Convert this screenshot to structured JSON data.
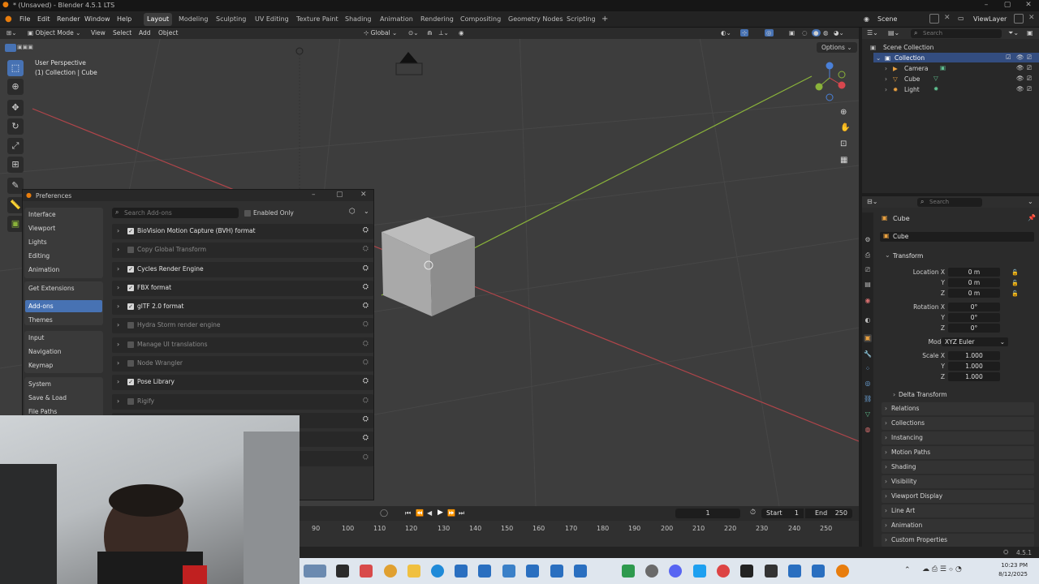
{
  "window": {
    "title": "* (Unsaved) - Blender 4.5.1 LTS"
  },
  "menu": {
    "items": [
      "File",
      "Edit",
      "Render",
      "Window",
      "Help"
    ],
    "workspaces": [
      "Layout",
      "Modeling",
      "Sculpting",
      "UV Editing",
      "Texture Paint",
      "Shading",
      "Animation",
      "Rendering",
      "Compositing",
      "Geometry Nodes",
      "Scripting"
    ],
    "active_workspace": "Layout",
    "add_workspace": "+",
    "scene": "Scene",
    "view_layer": "ViewLayer"
  },
  "viewport": {
    "mode": "Object Mode",
    "menus": [
      "View",
      "Select",
      "Add",
      "Object"
    ],
    "orientation": "Global",
    "options": "Options",
    "overlay_line1": "User Perspective",
    "overlay_line2": "(1) Collection | Cube"
  },
  "preferences": {
    "title": "Preferences",
    "search_placeholder": "Search Add-ons",
    "enabled_only": "Enabled Only",
    "categories_group1": [
      "Interface",
      "Viewport",
      "Lights",
      "Editing",
      "Animation"
    ],
    "categories_group2": [
      "Get Extensions",
      "Add-ons",
      "Themes"
    ],
    "categories_group3": [
      "Input",
      "Navigation",
      "Keymap"
    ],
    "categories_group4": [
      "System",
      "Save & Load",
      "File Paths"
    ],
    "active_category": "Add-ons",
    "addons": [
      {
        "name": "BioVision Motion Capture (BVH) format",
        "enabled": true
      },
      {
        "name": "Copy Global Transform",
        "enabled": false
      },
      {
        "name": "Cycles Render Engine",
        "enabled": true
      },
      {
        "name": "FBX format",
        "enabled": true
      },
      {
        "name": "glTF 2.0 format",
        "enabled": true
      },
      {
        "name": "Hydra Storm render engine",
        "enabled": false
      },
      {
        "name": "Manage UI translations",
        "enabled": false
      },
      {
        "name": "Node Wrangler",
        "enabled": false
      },
      {
        "name": "Pose Library",
        "enabled": true
      },
      {
        "name": "Rigify",
        "enabled": false
      }
    ]
  },
  "outliner": {
    "search_placeholder": "Search",
    "root": "Scene Collection",
    "collection": "Collection",
    "objects": [
      "Camera",
      "Cube",
      "Light"
    ]
  },
  "properties": {
    "search_placeholder": "Search",
    "object_name": "Cube",
    "data_name": "Cube",
    "panel_transform": "Transform",
    "location_label": "Location X",
    "location": [
      "0 m",
      "0 m",
      "0 m"
    ],
    "rotation_label": "Rotation X",
    "rotation": [
      "0°",
      "0°",
      "0°"
    ],
    "mode_label": "Mode",
    "mode_value": "XYZ Euler",
    "scale_label": "Scale X",
    "scale": [
      "1.000",
      "1.000",
      "1.000"
    ],
    "axis_y": "Y",
    "axis_z": "Z",
    "delta_transform": "Delta Transform",
    "panels": [
      "Relations",
      "Collections",
      "Instancing",
      "Motion Paths",
      "Shading",
      "Visibility",
      "Viewport Display",
      "Line Art",
      "Animation",
      "Custom Properties"
    ]
  },
  "timeline": {
    "current_frame": "1",
    "start_label": "Start",
    "start": "1",
    "end_label": "End",
    "end": "250",
    "ticks": [
      "90",
      "100",
      "110",
      "120",
      "130",
      "140",
      "150",
      "160",
      "170",
      "180",
      "190",
      "200",
      "210",
      "220",
      "230",
      "240",
      "250"
    ]
  },
  "statusbar": {
    "version": "4.5.1"
  },
  "taskbar": {
    "time": "10:23 PM",
    "date": "8/12/2025"
  },
  "colors": {
    "accent": "#4772b3",
    "grid_x_axis": "#b0454a",
    "grid_y_axis": "#8ab33a"
  }
}
